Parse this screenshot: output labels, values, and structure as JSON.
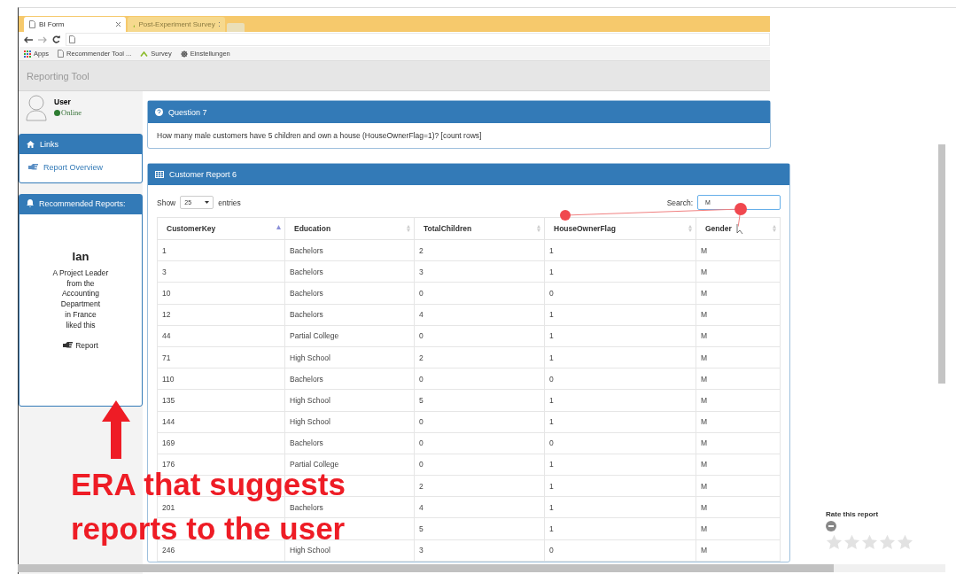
{
  "browser": {
    "tabs": [
      {
        "label": "BI Form",
        "selected": true
      },
      {
        "label": "Post-Experiment Survey",
        "selected": false
      }
    ],
    "bookmarks": [
      {
        "kind": "apps",
        "label": "Apps"
      },
      {
        "kind": "page",
        "label": "Recommender Tool ..."
      },
      {
        "kind": "survey",
        "label": "Survey"
      },
      {
        "kind": "gear",
        "label": "Einstellungen"
      }
    ]
  },
  "app": {
    "title": "Reporting Tool"
  },
  "user": {
    "name": "User",
    "status": "Online"
  },
  "links": {
    "title": "Links",
    "items": [
      "Report Overview"
    ]
  },
  "recommended": {
    "title": "Recommended Reports:",
    "person": "Ian",
    "description_lines": [
      "A Project Leader",
      "from the",
      "Accounting",
      "Department",
      "in France",
      "liked this"
    ],
    "link": "Report"
  },
  "question": {
    "title": "Question 7",
    "text": "How many male customers have 5 children and own a house (HouseOwnerFlag=1)? [count rows]"
  },
  "report": {
    "title": "Customer Report 6",
    "show_label": "Show",
    "page_size": "25",
    "entries_label": "entries",
    "search_label": "Search:",
    "search_value": "M",
    "columns": [
      {
        "label": "CustomerKey",
        "sorted": true
      },
      {
        "label": "Education",
        "sorted": false
      },
      {
        "label": "TotalChildren",
        "sorted": false
      },
      {
        "label": "HouseOwnerFlag",
        "sorted": false
      },
      {
        "label": "Gender",
        "sorted": false
      }
    ],
    "rows": [
      [
        "1",
        "Bachelors",
        "2",
        "1",
        "M"
      ],
      [
        "3",
        "Bachelors",
        "3",
        "1",
        "M"
      ],
      [
        "10",
        "Bachelors",
        "0",
        "0",
        "M"
      ],
      [
        "12",
        "Bachelors",
        "4",
        "1",
        "M"
      ],
      [
        "44",
        "Partial College",
        "0",
        "1",
        "M"
      ],
      [
        "71",
        "High School",
        "2",
        "1",
        "M"
      ],
      [
        "110",
        "Bachelors",
        "0",
        "0",
        "M"
      ],
      [
        "135",
        "High School",
        "5",
        "1",
        "M"
      ],
      [
        "144",
        "High School",
        "0",
        "1",
        "M"
      ],
      [
        "169",
        "Bachelors",
        "0",
        "0",
        "M"
      ],
      [
        "176",
        "Partial College",
        "0",
        "1",
        "M"
      ],
      [
        null,
        null,
        "2",
        "1",
        "M"
      ],
      [
        "201",
        "Bachelors",
        "4",
        "1",
        "M"
      ],
      [
        null,
        null,
        "5",
        "1",
        "M"
      ],
      [
        "246",
        "High School",
        "3",
        "0",
        "M"
      ]
    ]
  },
  "rating": {
    "label": "Rate this report",
    "stars": 0
  },
  "annotation": {
    "lines": [
      "ERA that suggests",
      "reports to the user"
    ]
  }
}
